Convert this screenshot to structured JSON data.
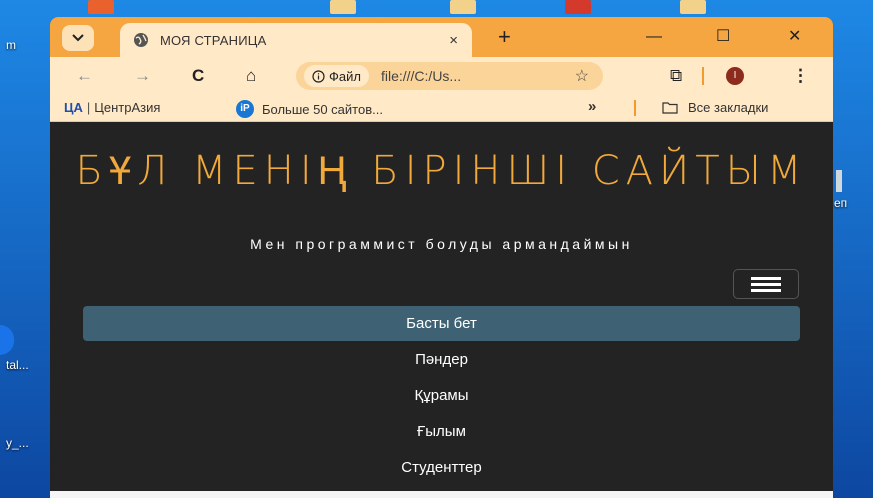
{
  "desktop": {
    "left_labels": [
      "m",
      "tal...",
      "y_..."
    ],
    "right_labels": [
      "еп"
    ]
  },
  "browser": {
    "tab": {
      "title": "МОЯ СТРАНИЦА",
      "close": "×"
    },
    "new_tab": "+",
    "window_buttons": {
      "minimize": "—",
      "maximize": "☐",
      "close": "✕"
    },
    "toolbar": {
      "back": "←",
      "forward": "→",
      "reload": "C",
      "home": "⌂",
      "site_info_label": "Файл",
      "url": "file:///C:/Us...",
      "bookmark_star": "☆",
      "extensions": "⧉",
      "profile_initial": "I",
      "menu": "⋮"
    },
    "bookmarks": {
      "items": [
        {
          "icon_text": "ЦА",
          "label": "ЦентрАзия"
        },
        {
          "icon_text": "iP",
          "label": "Больше 50 сайтов..."
        }
      ],
      "overflow": "»",
      "all_bookmarks": "Все закладки"
    }
  },
  "page": {
    "title": "БҰЛ МЕНІҢ БІРІНШІ САЙТЫМ",
    "subtitle": "Мен программист болуды армандаймын",
    "nav": [
      {
        "label": "Басты бет",
        "active": true
      },
      {
        "label": "Пәндер",
        "active": false
      },
      {
        "label": "Құрамы",
        "active": false
      },
      {
        "label": "Ғылым",
        "active": false
      },
      {
        "label": "Студенттер",
        "active": false
      }
    ]
  },
  "colors": {
    "tabbar": "#f6a641",
    "toolbar": "#ffe9c7",
    "page_bg": "#232323",
    "title": "#f2a93b",
    "active_nav": "#3e6274"
  }
}
